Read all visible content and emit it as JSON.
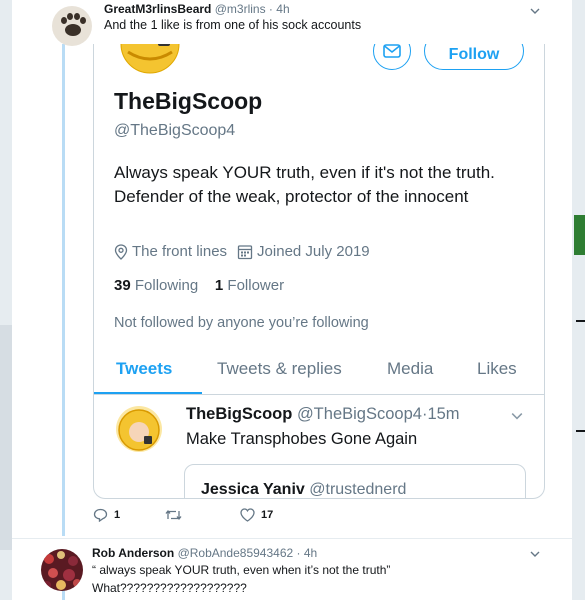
{
  "top_tweet": {
    "author_name": "GreatM3rlinsBeard",
    "author_handle": "@m3rlins",
    "time": "4h",
    "text": "And the 1 like is from one of his sock accounts"
  },
  "profile_card": {
    "follow_label": "Follow",
    "name": "TheBigScoop",
    "handle": "@TheBigScoop4",
    "bio": "Always speak YOUR truth, even if it's not the truth. Defender of the weak, protector of the innocent",
    "location": "The front lines",
    "joined": "Joined July 2019",
    "following_count": "39",
    "following_label": "Following",
    "followers_count": "1",
    "followers_label": "Follower",
    "not_followed_text": "Not followed by anyone you’re following",
    "tabs": [
      {
        "label": "Tweets",
        "active": true
      },
      {
        "label": "Tweets & replies",
        "active": false
      },
      {
        "label": "Media",
        "active": false
      },
      {
        "label": "Likes",
        "active": false
      }
    ],
    "inner_tweet": {
      "author_name": "TheBigScoop",
      "author_handle": "@TheBigScoop4",
      "time": "15m",
      "text": "Make Transphobes Gone Again",
      "quote": {
        "author_name": "Jessica Yaniv",
        "author_handle": "@trustednerd"
      }
    }
  },
  "actions": {
    "reply_count": "1",
    "retweet_count": "",
    "like_count": "17"
  },
  "bottom_tweet": {
    "author_name": "Rob Anderson",
    "author_handle": "@RobAnde85943462",
    "time": "4h",
    "text_line1": "“ always speak YOUR truth, even when it’s not the truth”",
    "text_line2": "What???????????????????"
  },
  "colors": {
    "accent": "#1da1f2",
    "thread_line": "#b9dcf5",
    "muted_text": "#657786",
    "border": "#ccd6dd"
  },
  "icons": [
    "paw-avatar",
    "mail-icon",
    "location-pin-icon",
    "calendar-icon",
    "chevron-down-icon",
    "reply-icon",
    "retweet-icon",
    "heart-icon"
  ]
}
